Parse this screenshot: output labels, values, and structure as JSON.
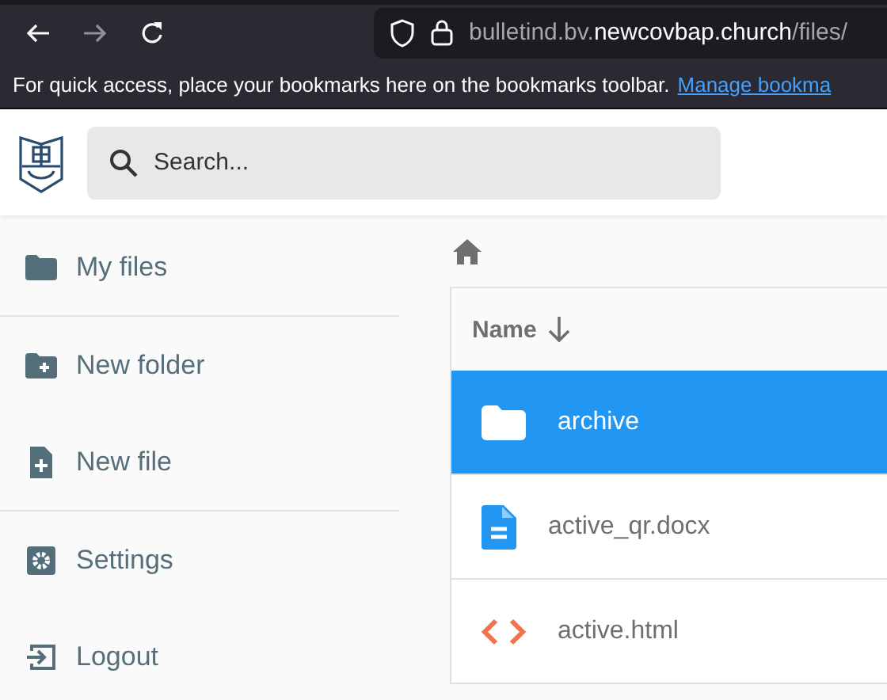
{
  "browser": {
    "url_prefix": "bulletind.bv.",
    "url_domain": "newcovbap.church",
    "url_suffix": "/files/",
    "bookmarks_hint": "For quick access, place your bookmarks here on the bookmarks toolbar.",
    "bookmarks_link": "Manage bookma"
  },
  "header": {
    "search": {
      "placeholder": "Search..."
    }
  },
  "sidebar": {
    "sections": [
      [
        {
          "kind": "folder",
          "label": "My files"
        }
      ],
      [
        {
          "kind": "new-folder",
          "label": "New folder"
        },
        {
          "kind": "new-file",
          "label": "New file"
        }
      ],
      [
        {
          "kind": "settings",
          "label": "Settings"
        },
        {
          "kind": "logout",
          "label": "Logout"
        }
      ]
    ]
  },
  "table": {
    "column": "Name",
    "rows": [
      {
        "kind": "folder",
        "name": "archive",
        "selected": true
      },
      {
        "kind": "doc",
        "name": "active_qr.docx",
        "selected": false
      },
      {
        "kind": "code",
        "name": "active.html",
        "selected": false
      }
    ]
  }
}
